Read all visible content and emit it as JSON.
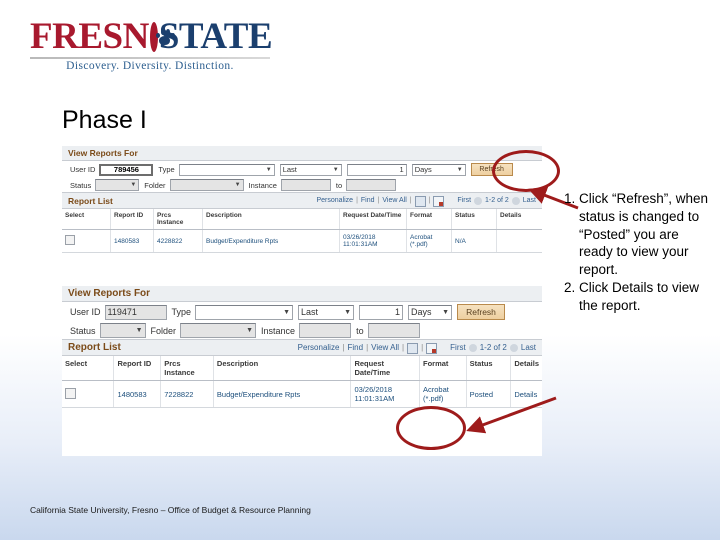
{
  "logo": {
    "word_part1": "FRESN",
    "word_part2": "STATE",
    "paw_icon": "paw-print-icon",
    "tagline": "Discovery. Diversity. Distinction.",
    "red": "#a8192e",
    "blue": "#1b3f6e"
  },
  "title": "Phase I",
  "panel1": {
    "header": "View Reports For",
    "user_id_label": "User ID",
    "user_id_value": "789456",
    "type_label": "Type",
    "type_value": "",
    "last_label": "Last",
    "last_count": "1",
    "days_label": "Days",
    "refresh_label": "Refresh",
    "status_label": "Status",
    "status_value": "",
    "folder_label": "Folder",
    "folder_value": "",
    "instance_label": "Instance",
    "instance_value": "",
    "to_label": "to",
    "to_value": "",
    "list": {
      "title": "Report List",
      "personalize": "Personalize",
      "find": "Find",
      "view_all": "View All",
      "grid_icon": "grid-view-icon",
      "excel_icon": "download-excel-icon",
      "first": "First",
      "range": "1-2 of 2",
      "last": "Last",
      "columns": [
        "Select",
        "Report ID",
        "Prcs Instance",
        "Description",
        "Request Date/Time",
        "Format",
        "Status",
        "Details"
      ],
      "rows": [
        {
          "select": "",
          "report_id": "1480583",
          "prcs_instance": "4228822",
          "description": "Budget/Expenditure Rpts",
          "request_date": "03/26/2018",
          "request_time": "11:01:31AM",
          "format_line1": "Acrobat",
          "format_line2": "(*.pdf)",
          "status": "N/A",
          "details": ""
        }
      ]
    }
  },
  "panel2": {
    "header": "View Reports For",
    "user_id_label": "User ID",
    "user_id_value": "119471",
    "type_label": "Type",
    "type_value": "",
    "last_label": "Last",
    "last_count": "1",
    "days_label": "Days",
    "refresh_label": "Refresh",
    "status_label": "Status",
    "status_value": "",
    "folder_label": "Folder",
    "folder_value": "",
    "instance_label": "Instance",
    "instance_value": "",
    "to_label": "to",
    "to_value": "",
    "list": {
      "title": "Report List",
      "personalize": "Personalize",
      "find": "Find",
      "view_all": "View All",
      "grid_icon": "grid-view-icon",
      "excel_icon": "download-excel-icon",
      "first": "First",
      "range": "1-2 of 2",
      "last": "Last",
      "columns": [
        "Select",
        "Report ID",
        "Prcs Instance",
        "Description",
        "Request Date/Time",
        "Format",
        "Status",
        "Details"
      ],
      "rows": [
        {
          "select": "",
          "report_id": "1480583",
          "prcs_instance": "7228822",
          "description": "Budget/Expenditure Rpts",
          "request_date": "03/26/2018",
          "request_time": "11:01:31AM",
          "format_line1": "Acrobat",
          "format_line2": "(*.pdf)",
          "status": "Posted",
          "details": "Details"
        }
      ]
    }
  },
  "annotations": {
    "color": "#9e1b1b",
    "ellipse_refresh": "highlight-refresh-button",
    "ellipse_details": "highlight-details-link"
  },
  "instructions": [
    "Click “Refresh”, when status is changed to “Posted” you are ready to view your report.",
    "Click Details to view the report."
  ],
  "footer": "California State University, Fresno – Office of Budget & Resource Planning"
}
